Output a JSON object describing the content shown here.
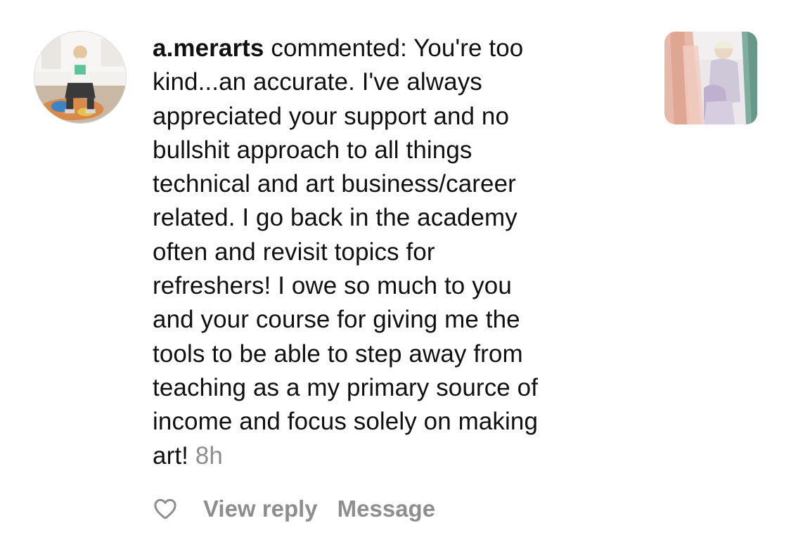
{
  "comment": {
    "username": "a.merarts",
    "text": " commented: You're too\nkind...an accurate. I've always\nappreciated your support and no\nbullshit approach to all things\ntechnical and art business/career\nrelated.  I go back in the academy\noften and revisit topics for\nrefreshers! I owe so much to you\nand your course for giving me the\ntools to be able to step away from\nteaching as a my primary source of\nincome and focus solely on making\nart! ",
    "timestamp": "8h"
  },
  "actions": {
    "like_icon": "heart-icon",
    "view_reply_label": "View reply",
    "message_label": "Message"
  },
  "colors": {
    "text": "#111111",
    "secondary": "#8e8e8e"
  }
}
